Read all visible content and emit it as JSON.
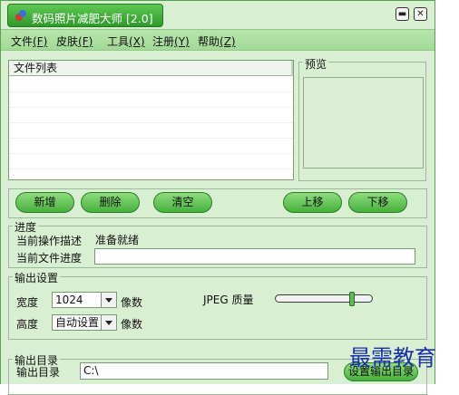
{
  "window": {
    "title": "数码照片减肥大师 [2.0]",
    "minimize_glyph": "▬",
    "close_glyph": "✕"
  },
  "menu": {
    "items": [
      {
        "label": "文件",
        "key": "(F)"
      },
      {
        "label": "皮肤",
        "key": "(F)"
      },
      {
        "label": "工具",
        "key": "(X)"
      },
      {
        "label": "注册",
        "key": "(Y)"
      },
      {
        "label": "帮助",
        "key": "(Z)"
      }
    ]
  },
  "file_list": {
    "header": "文件列表"
  },
  "preview": {
    "label": "预览"
  },
  "buttons": {
    "add": "新增",
    "delete": "删除",
    "clear": "清空",
    "move_up": "上移",
    "move_down": "下移"
  },
  "progress": {
    "group_label": "进度",
    "op_desc_label": "当前操作描述",
    "op_desc_value": "准备就绪",
    "file_progress_label": "当前文件进度"
  },
  "output_settings": {
    "group_label": "输出设置",
    "width_label": "宽度",
    "width_value": "1024",
    "height_label": "高度",
    "height_value": "自动设置",
    "unit": "像数",
    "jpeg_quality_label": "JPEG 质量",
    "jpeg_quality_fraction": 0.82
  },
  "output_dir": {
    "group_label": "输出目录",
    "label": "输出目录",
    "value": "C:\\",
    "button": "设置输出目录"
  },
  "watermark": "最需教育",
  "colors": {
    "accent": "#46b03c",
    "panel": "#d9efd2",
    "watermark": "#1a2fb0"
  }
}
